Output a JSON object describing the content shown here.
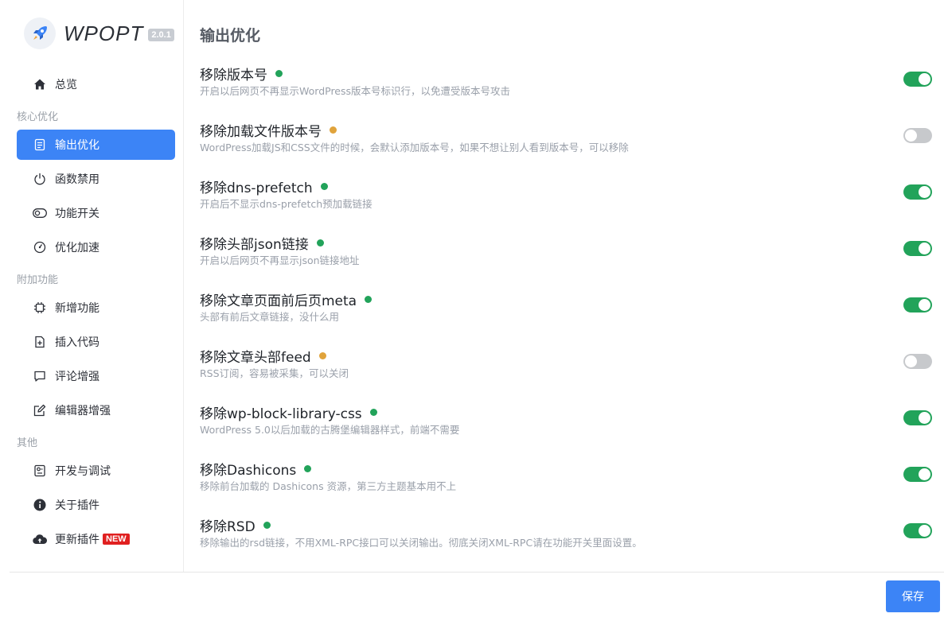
{
  "app": {
    "name": "WPOPT",
    "version": "2.0.1"
  },
  "sidebar": {
    "home": {
      "label": "总览",
      "icon": "home-icon"
    },
    "sections": [
      {
        "label": "核心优化"
      },
      {
        "label": "附加功能"
      },
      {
        "label": "其他"
      }
    ],
    "items": [
      {
        "label": "输出优化",
        "icon": "document-icon",
        "active": true
      },
      {
        "label": "函数禁用",
        "icon": "power-icon"
      },
      {
        "label": "功能开关",
        "icon": "toggle-icon"
      },
      {
        "label": "优化加速",
        "icon": "gauge-icon"
      },
      {
        "label": "新增功能",
        "icon": "chip-icon"
      },
      {
        "label": "插入代码",
        "icon": "file-plus-icon"
      },
      {
        "label": "评论增强",
        "icon": "comment-icon"
      },
      {
        "label": "编辑器增强",
        "icon": "edit-icon"
      },
      {
        "label": "开发与调试",
        "icon": "debug-icon"
      },
      {
        "label": "关于插件",
        "icon": "info-icon"
      },
      {
        "label": "更新插件",
        "icon": "cloud-upload-icon",
        "badge": "NEW"
      }
    ]
  },
  "main": {
    "title": "输出优化",
    "settings": [
      {
        "title": "移除版本号",
        "desc": "开启以后网页不再显示WordPress版本号标识行，以免遭受版本号攻击",
        "enabled": true,
        "status_color": "#22a35a"
      },
      {
        "title": "移除加载文件版本号",
        "desc": "WordPress加载JS和CSS文件的时候，会默认添加版本号，如果不想让别人看到版本号，可以移除",
        "enabled": false,
        "status_color": "#e0a33b"
      },
      {
        "title": "移除dns-prefetch",
        "desc": "开启后不显示dns-prefetch预加载链接",
        "enabled": true,
        "status_color": "#22a35a"
      },
      {
        "title": "移除头部json链接",
        "desc": "开启以后网页不再显示json链接地址",
        "enabled": true,
        "status_color": "#22a35a"
      },
      {
        "title": "移除文章页面前后页meta",
        "desc": "头部有前后文章链接，没什么用",
        "enabled": true,
        "status_color": "#22a35a"
      },
      {
        "title": "移除文章头部feed",
        "desc": "RSS订阅，容易被采集，可以关闭",
        "enabled": false,
        "status_color": "#e0a33b"
      },
      {
        "title": "移除wp-block-library-css",
        "desc": "WordPress 5.0以后加载的古腾堡编辑器样式，前端不需要",
        "enabled": true,
        "status_color": "#22a35a"
      },
      {
        "title": "移除Dashicons",
        "desc": "移除前台加载的 Dashicons 资源，第三方主题基本用不上",
        "enabled": true,
        "status_color": "#22a35a"
      },
      {
        "title": "移除RSD",
        "desc": "移除输出的rsd链接，不用XML-RPC接口可以关闭输出。彻底关闭XML-RPC请在功能开关里面设置。",
        "enabled": true,
        "status_color": "#22a35a"
      }
    ]
  },
  "footer": {
    "save_label": "保存"
  },
  "colors": {
    "accent": "#3c84f6",
    "toggle_on": "#22a35a",
    "toggle_off": "#c7c9cc",
    "status_on": "#22a35a",
    "status_warn": "#e0a33b",
    "badge": "#e02020"
  }
}
